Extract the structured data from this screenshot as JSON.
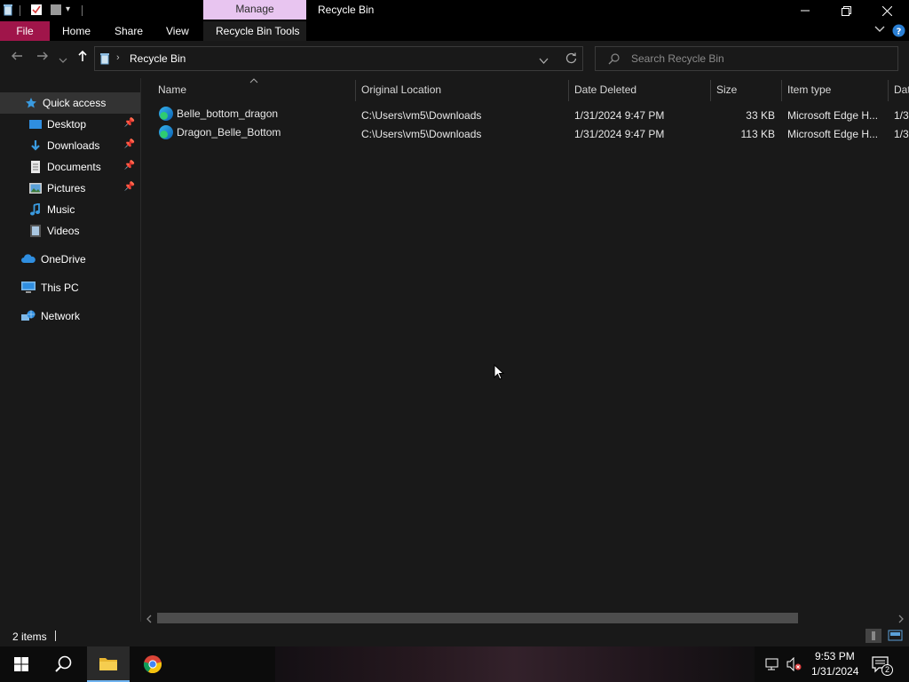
{
  "window": {
    "title": "Recycle Bin",
    "context_tab": "Manage",
    "accent_color": "#a0154a",
    "context_tab_color": "#e8c5f0"
  },
  "ribbon": {
    "file": "File",
    "home": "Home",
    "share": "Share",
    "view": "View",
    "context": "Recycle Bin Tools"
  },
  "address": {
    "path": "Recycle Bin",
    "search_placeholder": "Search Recycle Bin"
  },
  "nav": {
    "quick_access": "Quick access",
    "items": [
      {
        "label": "Desktop",
        "pinned": true
      },
      {
        "label": "Downloads",
        "pinned": true
      },
      {
        "label": "Documents",
        "pinned": true
      },
      {
        "label": "Pictures",
        "pinned": true
      },
      {
        "label": "Music"
      },
      {
        "label": "Videos"
      }
    ],
    "onedrive": "OneDrive",
    "thispc": "This PC",
    "network": "Network"
  },
  "columns": {
    "name": "Name",
    "original_location": "Original Location",
    "date_deleted": "Date Deleted",
    "size": "Size",
    "item_type": "Item type",
    "date_modified": "Dat"
  },
  "files": [
    {
      "name": "Belle_bottom_dragon",
      "location": "C:\\Users\\vm5\\Downloads",
      "deleted": "1/31/2024 9:47 PM",
      "size": "33 KB",
      "type": "Microsoft Edge H...",
      "modified": "1/3"
    },
    {
      "name": "Dragon_Belle_Bottom",
      "location": "C:\\Users\\vm5\\Downloads",
      "deleted": "1/31/2024 9:47 PM",
      "size": "113 KB",
      "type": "Microsoft Edge H...",
      "modified": "1/3"
    }
  ],
  "status": {
    "items": "2 items"
  },
  "taskbar": {
    "time": "9:53 PM",
    "date": "1/31/2024",
    "notifications": "2"
  }
}
